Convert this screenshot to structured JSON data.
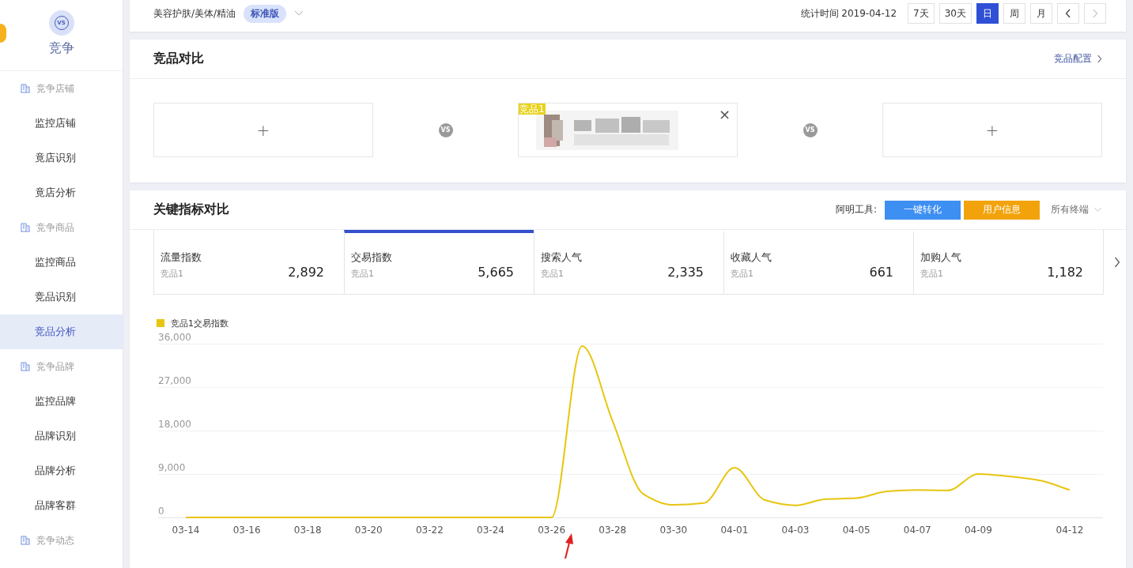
{
  "sidebar": {
    "logo": "VS",
    "title": "竞争",
    "groups": [
      {
        "label": "竞争店铺",
        "items": [
          {
            "label": "监控店铺",
            "selected": false
          },
          {
            "label": "竟店识别",
            "selected": false
          },
          {
            "label": "竟店分析",
            "selected": false
          }
        ]
      },
      {
        "label": "竞争商品",
        "items": [
          {
            "label": "监控商品",
            "selected": false
          },
          {
            "label": "竞品识别",
            "selected": false
          },
          {
            "label": "竞品分析",
            "selected": true
          }
        ]
      },
      {
        "label": "竞争品牌",
        "items": [
          {
            "label": "监控品牌",
            "selected": false
          },
          {
            "label": "品牌识别",
            "selected": false
          },
          {
            "label": "品牌分析",
            "selected": false
          },
          {
            "label": "品牌客群",
            "selected": false
          }
        ]
      },
      {
        "label": "竞争动态"
      }
    ]
  },
  "topbar": {
    "category": "美容护肤/美体/精油",
    "badge": "标准版",
    "stat_time": "统计时间 2019-04-12",
    "ranges": [
      {
        "label": "7天",
        "selected": false
      },
      {
        "label": "30天",
        "selected": false
      },
      {
        "label": "日",
        "selected": true
      },
      {
        "label": "周",
        "selected": false
      },
      {
        "label": "月",
        "selected": false
      }
    ],
    "pager": {
      "prev_disabled": false,
      "next_disabled": true
    }
  },
  "compare": {
    "title": "竞品对比",
    "link": "竞品配置",
    "slots": [
      {
        "kind": "empty",
        "symbol": "+"
      },
      {
        "kind": "product",
        "tag": "竞品1",
        "symbol": "×"
      },
      {
        "kind": "empty",
        "symbol": "+"
      }
    ],
    "separators": [
      "VS",
      "VS"
    ]
  },
  "metrics": {
    "title": "关键指标对比",
    "tools_label": "阿明工具:",
    "tools": [
      {
        "label": "一键转化",
        "color": "#3d8ff2"
      },
      {
        "label": "用户信息",
        "color": "#f2a30c"
      }
    ],
    "terminal": "所有终端",
    "tabs": [
      {
        "name": "流量指数",
        "sub": "竞品1",
        "value": "2,892",
        "selected": false
      },
      {
        "name": "交易指数",
        "sub": "竞品1",
        "value": "5,665",
        "selected": true
      },
      {
        "name": "搜索人气",
        "sub": "竞品1",
        "value": "2,335",
        "selected": false
      },
      {
        "name": "收藏人气",
        "sub": "竞品1",
        "value": "661",
        "selected": false
      },
      {
        "name": "加购人气",
        "sub": "竞品1",
        "value": "1,182",
        "selected": false
      }
    ],
    "chart_data": {
      "type": "line",
      "grid": true,
      "categories": [
        "03-14",
        null,
        "03-16",
        null,
        "03-18",
        null,
        "03-20",
        null,
        "03-22",
        null,
        "03-24",
        null,
        "03-26",
        null,
        "03-28",
        null,
        "03-30",
        null,
        "04-01",
        null,
        "04-03",
        null,
        "04-05",
        null,
        "04-07",
        null,
        "04-09",
        null,
        null,
        "04-12"
      ],
      "series": [
        {
          "name": "竞品1交易指数",
          "color": "#e8c510",
          "values": [
            0,
            0,
            0,
            0,
            0,
            0,
            0,
            0,
            0,
            0,
            0,
            0,
            0,
            35500,
            20000,
            4900,
            2600,
            3000,
            10300,
            3600,
            2500,
            3800,
            4000,
            5400,
            5700,
            5600,
            9000,
            8500,
            7700,
            5700
          ]
        }
      ],
      "ylim": [
        0,
        36000
      ],
      "yticks": [
        {
          "value": 0,
          "label": "0"
        },
        {
          "value": 9000,
          "label": "9,000"
        },
        {
          "value": 18000,
          "label": "18,000"
        },
        {
          "value": 27000,
          "label": "27,000"
        },
        {
          "value": 36000,
          "label": "36,000"
        }
      ]
    }
  }
}
